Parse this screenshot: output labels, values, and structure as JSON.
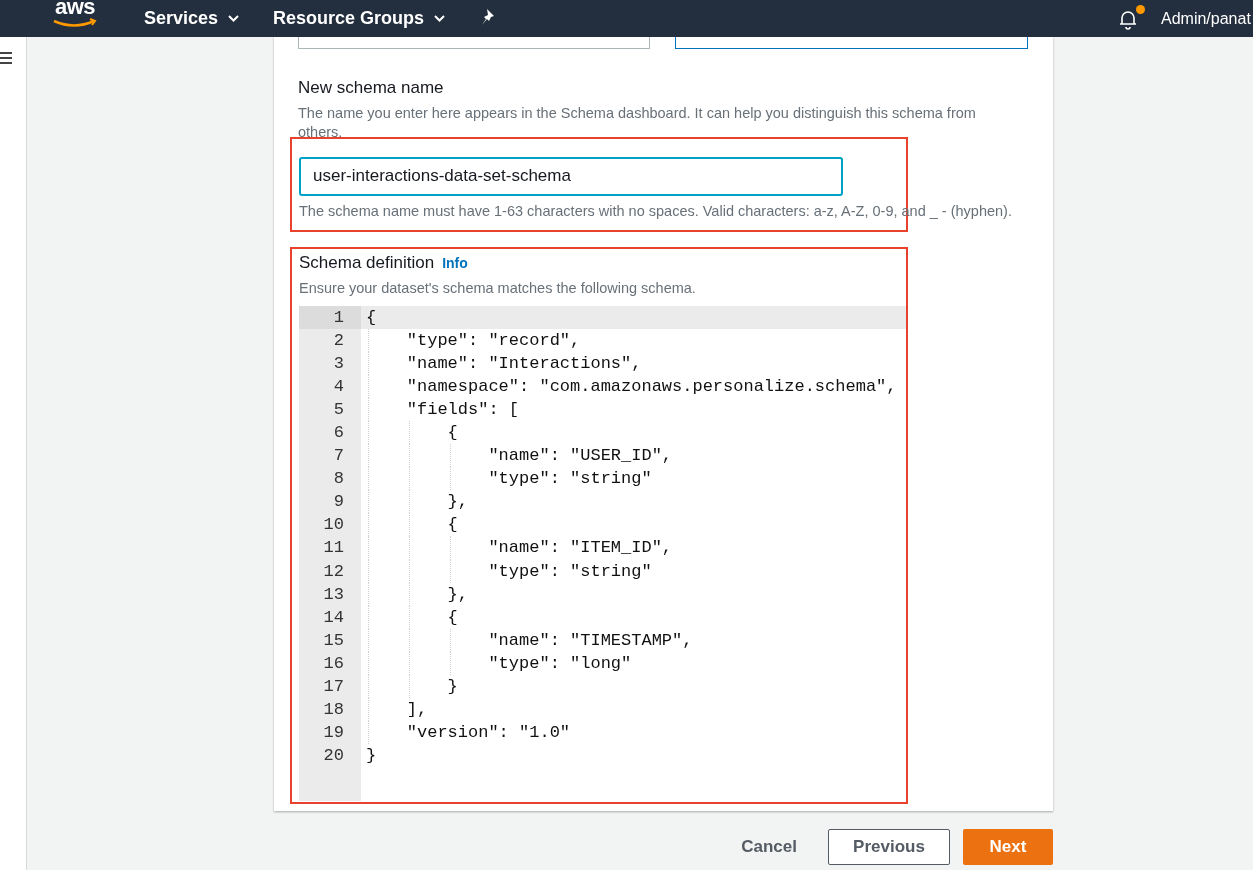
{
  "top_nav": {
    "logo": "aws",
    "menus": [
      {
        "label": "Services",
        "caret": true
      },
      {
        "label": "Resource Groups",
        "caret": true
      }
    ],
    "notification": true,
    "account": "Admin/panat"
  },
  "schema_name": {
    "label": "New schema name",
    "description": "The name you enter here appears in the Schema dashboard. It can help you distinguish this schema from others.",
    "value": "user-interactions-data-set-schema",
    "hint": "The schema name must have 1-63 characters with no spaces. Valid characters: a-z, A-Z, 0-9, and _ - (hyphen)."
  },
  "schema_definition": {
    "label": "Schema definition",
    "info_link": "Info",
    "description": "Ensure your dataset's schema matches the following schema.",
    "lines": [
      {
        "number": "1",
        "text": "{",
        "selected": true
      },
      {
        "number": "2",
        "text": "    \"type\": \"record\",",
        "selected": false
      },
      {
        "number": "3",
        "text": "    \"name\": \"Interactions\",",
        "selected": false
      },
      {
        "number": "4",
        "text": "    \"namespace\": \"com.amazonaws.personalize.schema\",",
        "selected": false
      },
      {
        "number": "5",
        "text": "    \"fields\": [",
        "selected": false
      },
      {
        "number": "6",
        "text": "        {",
        "selected": false
      },
      {
        "number": "7",
        "text": "            \"name\": \"USER_ID\",",
        "selected": false
      },
      {
        "number": "8",
        "text": "            \"type\": \"string\"",
        "selected": false
      },
      {
        "number": "9",
        "text": "        },",
        "selected": false
      },
      {
        "number": "10",
        "text": "        {",
        "selected": false
      },
      {
        "number": "11",
        "text": "            \"name\": \"ITEM_ID\",",
        "selected": false
      },
      {
        "number": "12",
        "text": "            \"type\": \"string\"",
        "selected": false
      },
      {
        "number": "13",
        "text": "        },",
        "selected": false
      },
      {
        "number": "14",
        "text": "        {",
        "selected": false
      },
      {
        "number": "15",
        "text": "            \"name\": \"TIMESTAMP\",",
        "selected": false
      },
      {
        "number": "16",
        "text": "            \"type\": \"long\"",
        "selected": false
      },
      {
        "number": "17",
        "text": "        }",
        "selected": false
      },
      {
        "number": "18",
        "text": "    ],",
        "selected": false
      },
      {
        "number": "19",
        "text": "    \"version\": \"1.0\"",
        "selected": false
      },
      {
        "number": "20",
        "text": "}",
        "selected": false
      }
    ]
  },
  "buttons": [
    {
      "label": "Cancel",
      "kind": "link"
    },
    {
      "label": "Previous",
      "kind": "secondary"
    },
    {
      "label": "Next",
      "kind": "primary"
    }
  ]
}
